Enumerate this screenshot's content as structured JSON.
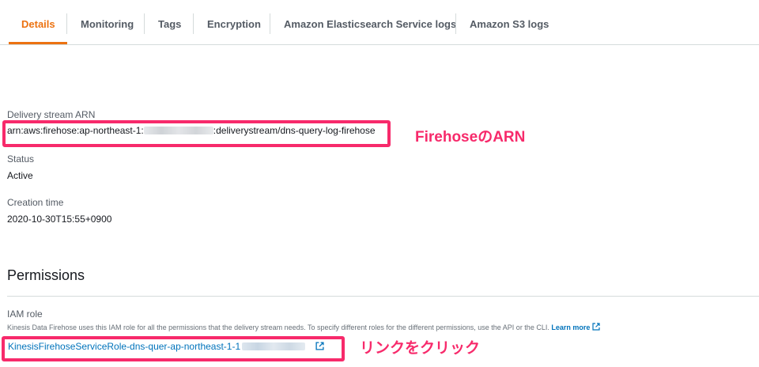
{
  "tabs": [
    {
      "label": "Details",
      "active": true
    },
    {
      "label": "Monitoring",
      "active": false
    },
    {
      "label": "Tags",
      "active": false
    },
    {
      "label": "Encryption",
      "active": false
    },
    {
      "label": "Amazon Elasticsearch Service logs",
      "active": false
    },
    {
      "label": "Amazon S3 logs",
      "active": false
    }
  ],
  "details": {
    "arn_label": "Delivery stream ARN",
    "arn_prefix": "arn:aws:firehose:ap-northeast-1:",
    "arn_suffix": ":deliverystream/dns-query-log-firehose",
    "status_label": "Status",
    "status_value": "Active",
    "creation_label": "Creation time",
    "creation_value": "2020-10-30T15:55+0900"
  },
  "annotations": {
    "arn": "FirehoseのARN",
    "role": "リンクをクリック"
  },
  "permissions": {
    "title": "Permissions",
    "iam_label": "IAM role",
    "description": "Kinesis Data Firehose uses this IAM role for all the permissions that the delivery stream needs. To specify different roles for the different permissions, use the API or the CLI.",
    "learn_more": "Learn more",
    "role_link_prefix": "KinesisFirehoseServiceRole-dns-quer-ap-northeast-1-1"
  },
  "colors": {
    "accent": "#ec7211",
    "annotation": "#f72a6b",
    "link": "#0073bb"
  },
  "icons": {
    "external_link": "external-link-icon"
  }
}
